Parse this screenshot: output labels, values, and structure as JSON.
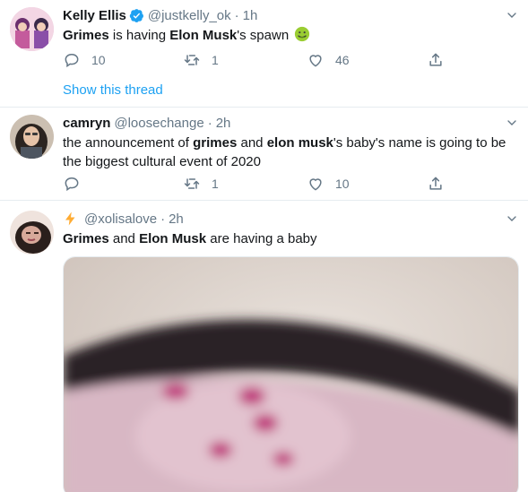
{
  "tweets": [
    {
      "name": "Kelly Ellis",
      "verified": true,
      "handle": "@justkelly_ok",
      "sep": "·",
      "time": "1h",
      "text_parts": [
        "Grimes",
        " is having ",
        "Elon Musk",
        "'s spawn "
      ],
      "emoji": "nauseated-face",
      "replies": "10",
      "retweets": "1",
      "likes": "46",
      "show_thread": "Show this thread"
    },
    {
      "name": "camryn",
      "handle": "@loosechange",
      "sep": "·",
      "time": "2h",
      "text_parts": [
        "the announcement of ",
        "grimes",
        " and ",
        "elon musk",
        "'s baby's name is going to be",
        "the biggest cultural event of 2020"
      ],
      "replies": "",
      "retweets": "1",
      "likes": "10"
    },
    {
      "name_icon": "lightning-bolt",
      "handle": "@xolisalove",
      "sep": "·",
      "time": "2h",
      "text_parts": [
        "Grimes",
        " and ",
        "Elon Musk",
        " are having a baby"
      ]
    }
  ],
  "colors": {
    "text": "#14171a",
    "secondary": "#657786",
    "link": "#1da1f2",
    "verified": "#1da1f2",
    "border": "#e6ecf0",
    "emoji_face": "#9acd32",
    "media_bg": "#d9cfc8",
    "hair": "#2a2228",
    "skin": "#d8b7c4",
    "nails": "#c0307a"
  }
}
